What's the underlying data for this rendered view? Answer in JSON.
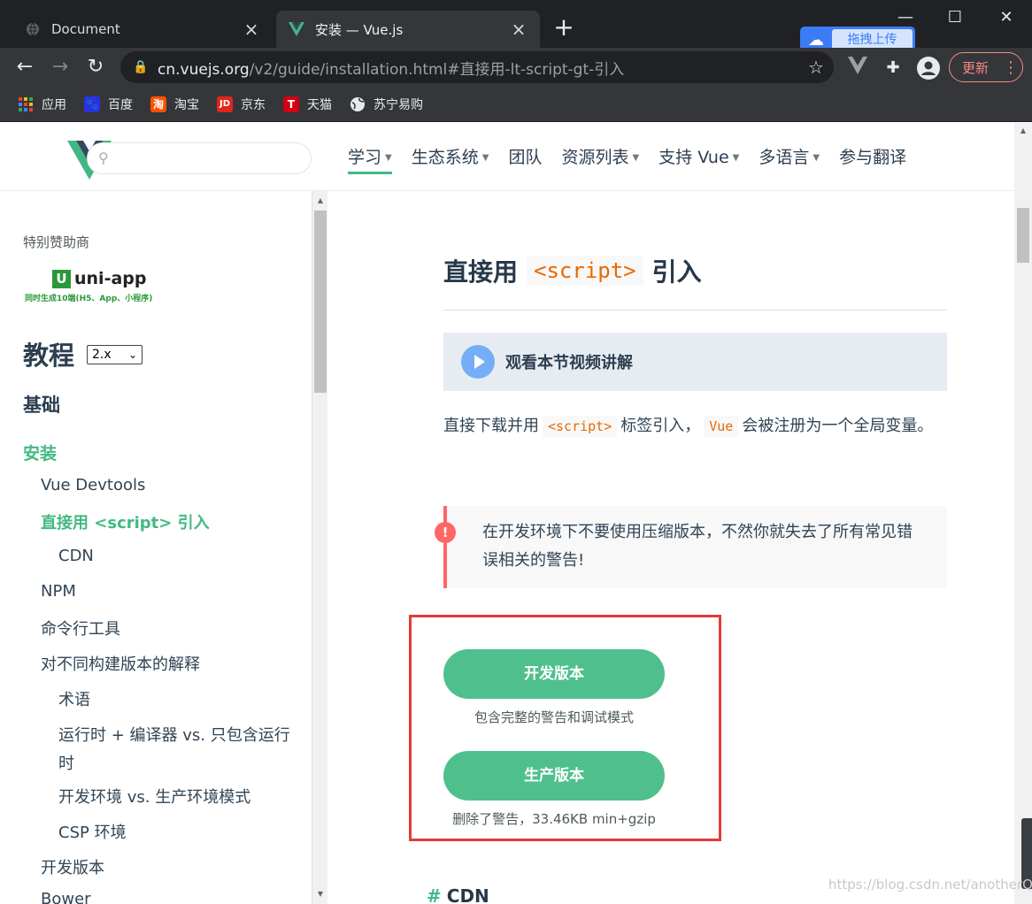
{
  "browser": {
    "tabs": [
      {
        "title": "Document",
        "icon": "globe-icon"
      },
      {
        "title": "安装 — Vue.js",
        "icon": "vue-logo-icon"
      }
    ],
    "url_host": "cn.vuejs.org",
    "url_path": "/v2/guide/installation.html#直接用-lt-script-gt-引入",
    "update_label": "更新",
    "upload_ext_label": "拖拽上传",
    "bookmarks": [
      {
        "label": "应用",
        "icon": "apps-grid-icon",
        "color": "#ea4335"
      },
      {
        "label": "百度",
        "icon": "baidu-paw-icon",
        "color": "#2932e1"
      },
      {
        "label": "淘宝",
        "icon": "taobao-icon",
        "color": "#ff5000"
      },
      {
        "label": "京东",
        "icon": "jd-icon",
        "color": "#e1251b"
      },
      {
        "label": "天猫",
        "icon": "tmall-icon",
        "color": "#d10013"
      },
      {
        "label": "苏宁易购",
        "icon": "globe-icon",
        "color": "#e8eaed"
      }
    ]
  },
  "header": {
    "search_placeholder": "",
    "nav": [
      {
        "label": "学习",
        "dropdown": true,
        "active": true
      },
      {
        "label": "生态系统",
        "dropdown": true
      },
      {
        "label": "团队",
        "dropdown": false
      },
      {
        "label": "资源列表",
        "dropdown": true
      },
      {
        "label": "支持 Vue",
        "dropdown": true
      },
      {
        "label": "多语言",
        "dropdown": true
      },
      {
        "label": "参与翻译",
        "dropdown": false
      }
    ]
  },
  "sidebar": {
    "sponsor_label": "特别赞助商",
    "sponsor_name": "uni-app",
    "sponsor_tagline": "同时生成10端(H5、App、小程序)",
    "tutorial_title": "教程",
    "version": "2.x",
    "section_basics": "基础",
    "section_install": "安装",
    "links": {
      "devtools": "Vue Devtools",
      "direct_pre": "直接用 ",
      "direct_code": "<script>",
      "direct_post": " 引入",
      "cdn": "CDN",
      "npm": "NPM",
      "cli": "命令行工具",
      "builds": "对不同构建版本的解释",
      "terms": "术语",
      "runtime_l1": "运行时 + 编译器 vs. 只包含运行",
      "runtime_l2": "时",
      "devprod": "开发环境 vs. 生产环境模式",
      "csp": "CSP 环境",
      "devbuild": "开发版本",
      "bower": "Bower"
    }
  },
  "content": {
    "heading_pre": "直接用",
    "heading_code": "<script>",
    "heading_post": "引入",
    "video_label": "观看本节视频讲解",
    "para_1": "直接下载并用",
    "para_code_1": "<script>",
    "para_2": "标签引入，",
    "para_code_2": "Vue",
    "para_3": "会被注册为一个全局变量。",
    "warning": "在开发环境下不要使用压缩版本，不然你就失去了所有常见错误相关的警告!",
    "dev_button": "开发版本",
    "dev_caption": "包含完整的警告和调试模式",
    "prod_button": "生产版本",
    "prod_caption": "删除了警告，33.46KB min+gzip",
    "next_heading": "CDN"
  },
  "watermark": "https://blog.csdn.net/anotherQu",
  "colors": {
    "accent": "#42b983",
    "button": "#4fc08d",
    "code": "#e96900",
    "warning": "#ff6666",
    "highlight_box": "#e23b3b"
  }
}
